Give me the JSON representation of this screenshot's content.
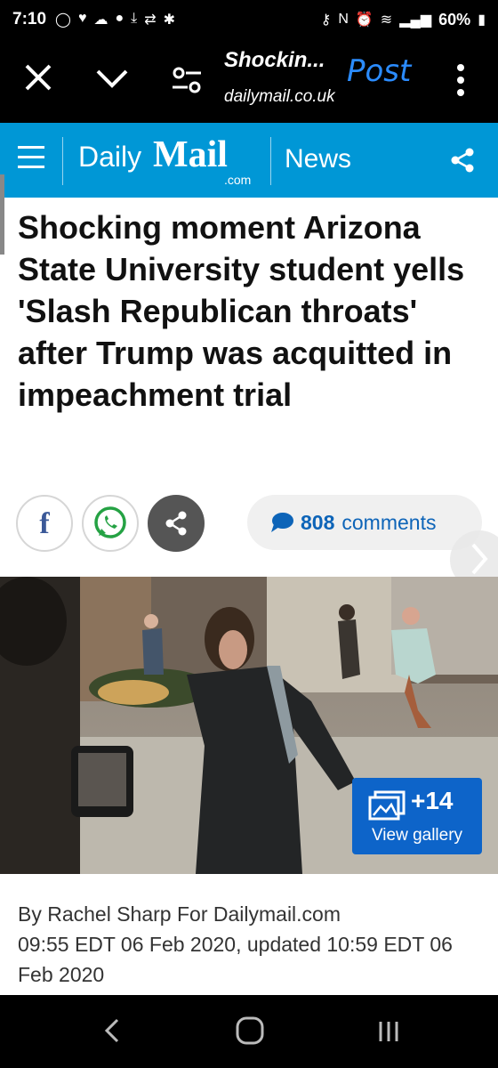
{
  "status_bar": {
    "time": "7:10",
    "battery": "60%"
  },
  "toolbar": {
    "title": "Shockin...",
    "url": "dailymail.co.uk",
    "post_label": "Post"
  },
  "header": {
    "brand_daily": "Daily",
    "brand_mail": "Mail",
    "brand_com": ".com",
    "section": "News"
  },
  "article": {
    "headline": "Shocking moment Arizona State University student yells 'Slash Republican throats' after Trump was acquitted in impeachment trial",
    "comments_count": "808",
    "comments_label": "comments",
    "gallery_count": "+14",
    "gallery_label": "View gallery",
    "byline": "By Rachel Sharp For Dailymail.com",
    "dates": "09:55 EDT 06 Feb 2020, updated 10:59 EDT 06 Feb 2020"
  },
  "social": {
    "facebook_letter": "f"
  },
  "colors": {
    "header_blue": "#0097d6",
    "link_blue": "#0d64b8",
    "gallery_blue": "#0d64c9",
    "post_blue": "#2b8cff"
  },
  "icons": [
    "close-icon",
    "chevron-down-icon",
    "tune-icon",
    "more-vert-icon",
    "menu-icon",
    "share-icon",
    "whatsapp-icon",
    "comment-icon",
    "chevron-right-icon",
    "gallery-icon",
    "nav-back-icon",
    "nav-home-icon",
    "nav-recents-icon"
  ]
}
